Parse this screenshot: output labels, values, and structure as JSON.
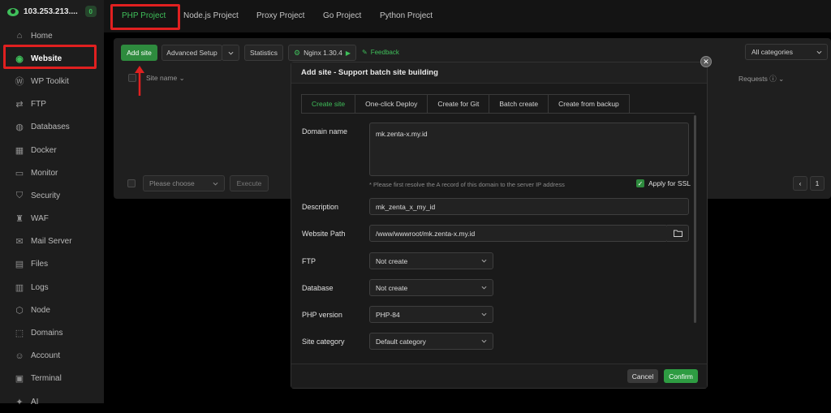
{
  "server": {
    "ip": "103.253.213....",
    "badge": "0"
  },
  "sidebar": {
    "items": [
      {
        "label": "Home",
        "icon": "home-icon",
        "glyph": "⌂"
      },
      {
        "label": "Website",
        "icon": "globe-icon",
        "glyph": "◉",
        "active": true
      },
      {
        "label": "WP Toolkit",
        "icon": "wordpress-icon",
        "glyph": "Ⓦ"
      },
      {
        "label": "FTP",
        "icon": "transfer-icon",
        "glyph": "⇄"
      },
      {
        "label": "Databases",
        "icon": "database-icon",
        "glyph": "◍"
      },
      {
        "label": "Docker",
        "icon": "docker-icon",
        "glyph": "▦"
      },
      {
        "label": "Monitor",
        "icon": "monitor-icon",
        "glyph": "▭"
      },
      {
        "label": "Security",
        "icon": "shield-icon",
        "glyph": "⛉"
      },
      {
        "label": "WAF",
        "icon": "firewall-icon",
        "glyph": "♜"
      },
      {
        "label": "Mail Server",
        "icon": "mail-icon",
        "glyph": "✉"
      },
      {
        "label": "Files",
        "icon": "folder-icon",
        "glyph": "▤"
      },
      {
        "label": "Logs",
        "icon": "logs-icon",
        "glyph": "▥"
      },
      {
        "label": "Node",
        "icon": "node-icon",
        "glyph": "⬡"
      },
      {
        "label": "Domains",
        "icon": "domains-icon",
        "glyph": "⬚"
      },
      {
        "label": "Account",
        "icon": "user-icon",
        "glyph": "☺"
      },
      {
        "label": "Terminal",
        "icon": "terminal-icon",
        "glyph": "▣"
      },
      {
        "label": "AI",
        "icon": "ai-icon",
        "glyph": "✦"
      }
    ]
  },
  "top_tabs": [
    "PHP Project",
    "Node.js Project",
    "Proxy Project",
    "Go Project",
    "Python Project"
  ],
  "toolbar": {
    "add_site": "Add site",
    "advanced_setup": "Advanced Setup",
    "statistics": "Statistics",
    "nginx": "Nginx 1.30.4",
    "feedback": "Feedback",
    "categories": "All categories"
  },
  "table": {
    "site_name": "Site name",
    "requests": "Requests"
  },
  "bulk": {
    "placeholder": "Please choose",
    "execute": "Execute",
    "page": "1"
  },
  "modal": {
    "title": "Add site - Support batch site building",
    "tabs": [
      "Create site",
      "One-click Deploy",
      "Create for Git",
      "Batch create",
      "Create from backup"
    ],
    "domain_label": "Domain name",
    "domain_value": "mk.zenta-x.my.id",
    "hint": "* Please first resolve the A record of this domain to the server IP address",
    "ssl_label": "Apply for SSL",
    "description_label": "Description",
    "description_value": "mk_zenta_x_my_id",
    "path_label": "Website Path",
    "path_value": "/www/wwwroot/mk.zenta-x.my.id",
    "ftp_label": "FTP",
    "ftp_value": "Not create",
    "db_label": "Database",
    "db_value": "Not create",
    "php_label": "PHP version",
    "php_value": "PHP-84",
    "category_label": "Site category",
    "category_value": "Default category",
    "cancel": "Cancel",
    "confirm": "Confirm"
  },
  "colors": {
    "accent": "#3fbf5a",
    "highlight": "#e02020"
  }
}
